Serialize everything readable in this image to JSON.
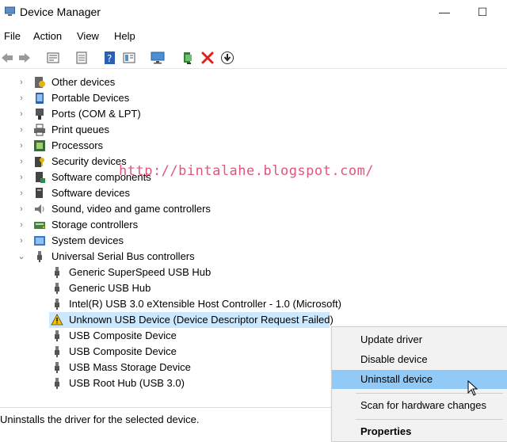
{
  "window": {
    "title": "Device Manager",
    "minimize_glyph": "—",
    "maximize_glyph": "☐"
  },
  "menu": [
    "File",
    "Action",
    "View",
    "Help"
  ],
  "toolbar_icons": [
    "back-icon",
    "forward-icon",
    "properties-icon",
    "update-driver-icon",
    "help-icon",
    "view-icon",
    "monitor-icon",
    "add-legacy-icon",
    "uninstall-icon",
    "download-icon"
  ],
  "tree": {
    "categories": [
      {
        "label": "Other devices",
        "icon": "other-devices-icon",
        "expanded": false
      },
      {
        "label": "Portable Devices",
        "icon": "portable-devices-icon",
        "expanded": false
      },
      {
        "label": "Ports (COM & LPT)",
        "icon": "ports-icon",
        "expanded": false
      },
      {
        "label": "Print queues",
        "icon": "printer-icon",
        "expanded": false
      },
      {
        "label": "Processors",
        "icon": "processor-icon",
        "expanded": false
      },
      {
        "label": "Security devices",
        "icon": "security-icon",
        "expanded": false
      },
      {
        "label": "Software components",
        "icon": "software-components-icon",
        "expanded": false
      },
      {
        "label": "Software devices",
        "icon": "software-devices-icon",
        "expanded": false
      },
      {
        "label": "Sound, video and game controllers",
        "icon": "speaker-icon",
        "expanded": false
      },
      {
        "label": "Storage controllers",
        "icon": "storage-icon",
        "expanded": false
      },
      {
        "label": "System devices",
        "icon": "system-devices-icon",
        "expanded": false
      },
      {
        "label": "Universal Serial Bus controllers",
        "icon": "usb-icon",
        "expanded": true
      }
    ],
    "usb_children": [
      {
        "label": "Generic SuperSpeed USB Hub",
        "warning": false
      },
      {
        "label": "Generic USB Hub",
        "warning": false
      },
      {
        "label": "Intel(R) USB 3.0 eXtensible Host Controller - 1.0 (Microsoft)",
        "warning": false
      },
      {
        "label": "Unknown USB Device (Device Descriptor Request Failed)",
        "warning": true,
        "selected": true
      },
      {
        "label": "USB Composite Device",
        "warning": false
      },
      {
        "label": "USB Composite Device",
        "warning": false
      },
      {
        "label": "USB Mass Storage Device",
        "warning": false
      },
      {
        "label": "USB Root Hub (USB 3.0)",
        "warning": false
      }
    ]
  },
  "watermark": "http://bintalahe.blogspot.com/",
  "context_menu": {
    "items": [
      {
        "label": "Update driver"
      },
      {
        "label": "Disable device"
      },
      {
        "label": "Uninstall device",
        "highlighted": true
      },
      {
        "label": "Scan for hardware changes"
      },
      {
        "label": "Properties",
        "bold": true
      }
    ]
  },
  "status": "Uninstalls the driver for the selected device.",
  "colors": {
    "selection": "#cce8ff",
    "menu_highlight": "#91c9f7",
    "watermark": "#e1567a",
    "delete_red": "#e0201b"
  }
}
